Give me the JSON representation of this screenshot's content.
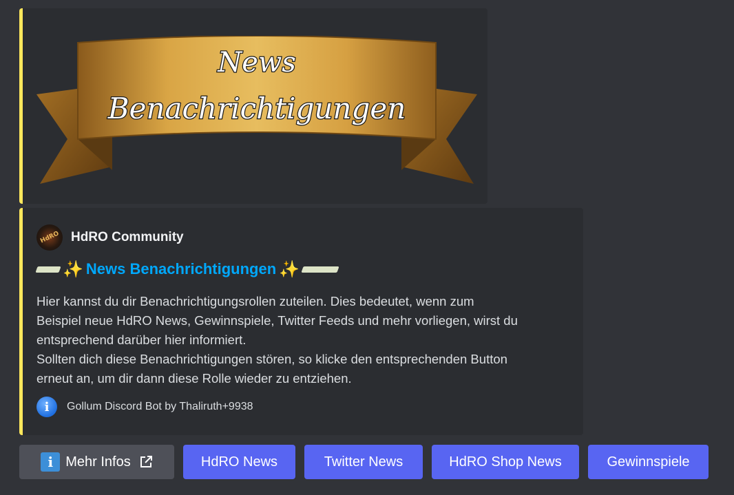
{
  "banner": {
    "line1": "News",
    "line2": "Benachrichtigungen"
  },
  "embed": {
    "author": {
      "name": "HdRO Community",
      "avatar_text": "HdRO"
    },
    "title": "News Benachrichtigungen",
    "description": "Hier kannst du dir Benachrichtigungsrollen zuteilen. Dies bedeutet, wenn zum\nBeispiel neue HdRO News, Gewinnspiele, Twitter Feeds und mehr vorliegen, wirst du\nentsprechend darüber hier informiert.\nSollten dich diese Benachrichtigungen stören, so klicke den entsprechenden Button\nerneut an, um dir dann diese Rolle wieder zu entziehen.",
    "footer": "Gollum Discord Bot by Thaliruth+9938",
    "accent_color": "#fee75c",
    "title_color": "#00a8fc"
  },
  "buttons": {
    "mehr_infos": "Mehr Infos",
    "hdro_news": "HdRO News",
    "twitter_news": "Twitter News",
    "hdro_shop_news": "HdRO Shop News",
    "gewinnspiele": "Gewinnspiele",
    "primary_color": "#5865f2"
  }
}
